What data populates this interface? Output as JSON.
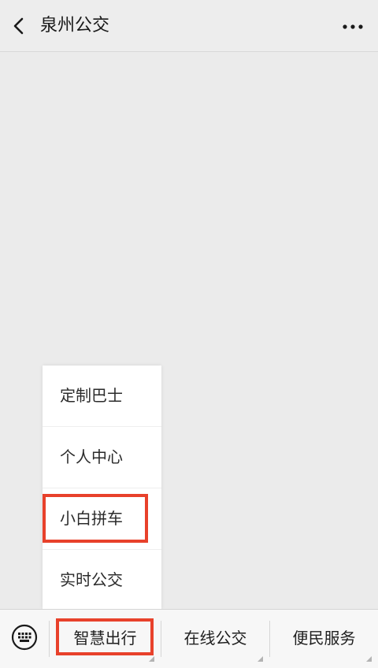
{
  "navbar": {
    "title": "泉州公交",
    "back_icon": "chevron-left-icon",
    "more_icon": "more-horizontal-icon"
  },
  "popup_menu": {
    "items": [
      {
        "label": "定制巴士"
      },
      {
        "label": "个人中心"
      },
      {
        "label": "小白拼车"
      },
      {
        "label": "实时公交"
      }
    ]
  },
  "bottom_menu": {
    "keyboard_icon": "keyboard-icon",
    "buttons": [
      {
        "label": "智慧出行"
      },
      {
        "label": "在线公交"
      },
      {
        "label": "便民服务"
      }
    ]
  },
  "colors": {
    "highlight": "#e8412b",
    "background": "#ebebeb"
  }
}
